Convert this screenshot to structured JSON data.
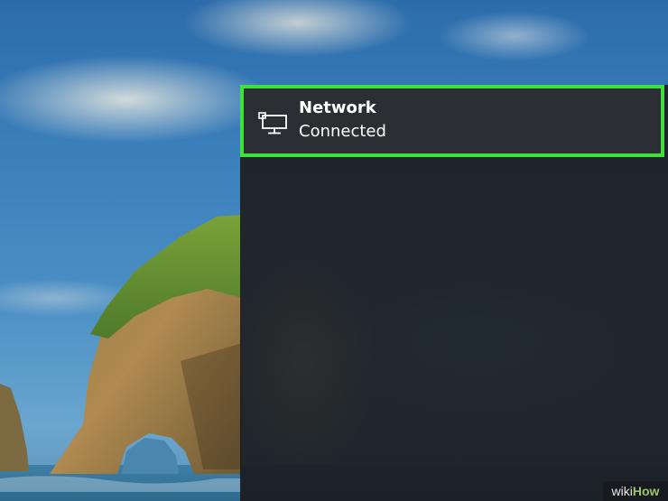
{
  "network_flyout": {
    "item": {
      "name": "Network",
      "status": "Connected",
      "icon": "wired-network-icon",
      "highlight_color": "#3ee03a"
    }
  },
  "watermark": {
    "prefix": "wiki",
    "suffix": "How"
  }
}
